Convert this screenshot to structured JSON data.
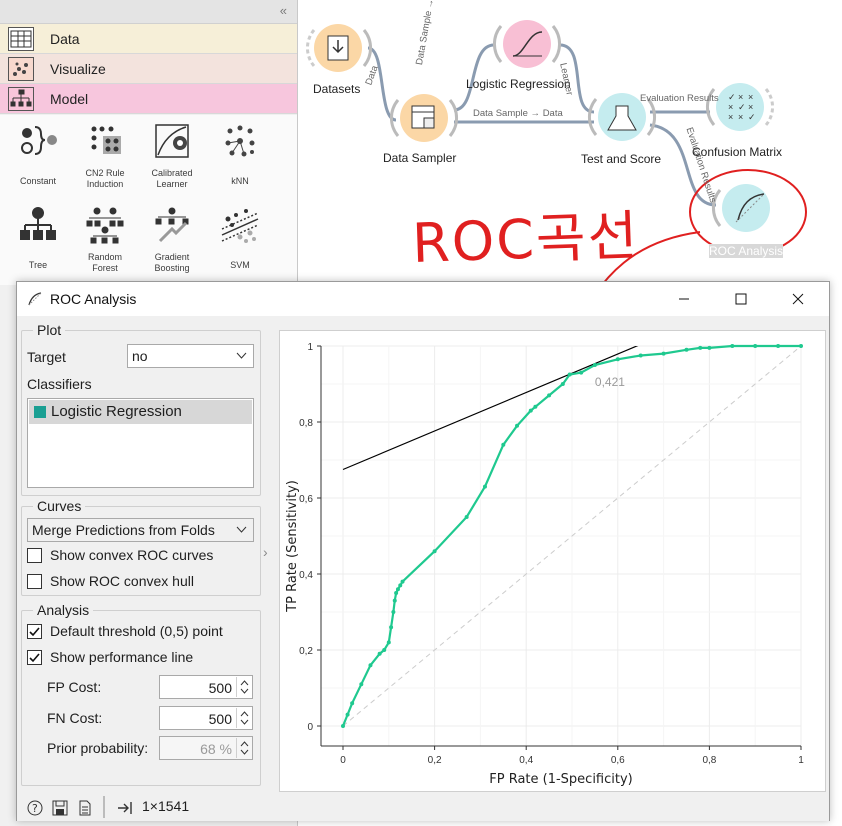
{
  "toolbox": {
    "categories": [
      {
        "label": "Data"
      },
      {
        "label": "Visualize"
      },
      {
        "label": "Model"
      }
    ],
    "widgets": [
      {
        "label": "Constant",
        "icon": "constant-icon"
      },
      {
        "label": "CN2 Rule\nInduction",
        "icon": "cn2-rule-induction-icon"
      },
      {
        "label": "Calibrated\nLearner",
        "icon": "calibrated-learner-icon"
      },
      {
        "label": "kNN",
        "icon": "knn-icon"
      },
      {
        "label": "Tree",
        "icon": "tree-icon"
      },
      {
        "label": "Random\nForest",
        "icon": "random-forest-icon"
      },
      {
        "label": "Gradient\nBoosting",
        "icon": "gradient-boosting-icon"
      },
      {
        "label": "SVM",
        "icon": "svm-icon"
      }
    ]
  },
  "workflow": {
    "nodes": {
      "datasets": "Datasets",
      "data_sampler": "Data Sampler",
      "logistic_regression": "Logistic Regression",
      "test_and_score": "Test and Score",
      "confusion_matrix": "Confusion Matrix",
      "roc_analysis": "ROC Analysis"
    },
    "links": {
      "datasets_to_sampler": "Data",
      "sampler_to_lr": "Data Sample → Data",
      "sampler_to_test": "Data Sample → Data",
      "lr_to_test": "Learner",
      "test_to_cm": "Evaluation Results",
      "test_to_roc": "Evaluation Results"
    },
    "annotation_text": "ROC곡선"
  },
  "roc_window": {
    "title": "ROC Analysis",
    "plot_group": {
      "title": "Plot",
      "target_label": "Target",
      "target_value": "no",
      "classifiers_label": "Classifiers",
      "classifiers": [
        "Logistic Regression"
      ]
    },
    "curves_group": {
      "title": "Curves",
      "merge_value": "Merge Predictions from Folds",
      "show_convex_curves": "Show convex ROC curves",
      "show_convex_hull": "Show ROC convex hull"
    },
    "analysis_group": {
      "title": "Analysis",
      "default_threshold": "Default threshold (0,5) point",
      "show_performance_line": "Show performance line",
      "fp_cost_label": "FP Cost:",
      "fp_cost": "500",
      "fn_cost_label": "FN Cost:",
      "fn_cost": "500",
      "prior_label": "Prior probability:",
      "prior": "68 %"
    },
    "status": {
      "summary": "1×1541"
    }
  },
  "chart_data": {
    "type": "line",
    "title": "",
    "xlabel": "FP Rate (1-Specificity)",
    "ylabel": "TP Rate (Sensitivity)",
    "xlim": [
      0,
      1
    ],
    "ylim": [
      0,
      1
    ],
    "x_ticks": [
      "0",
      "0,2",
      "0,4",
      "0,6",
      "0,8",
      "1"
    ],
    "y_ticks": [
      "0",
      "0,2",
      "0,4",
      "0,6",
      "0,8",
      "1"
    ],
    "grid": true,
    "series": [
      {
        "name": "Logistic Regression",
        "color": "#1fc98f",
        "x": [
          0.0,
          0.01,
          0.02,
          0.04,
          0.06,
          0.08,
          0.09,
          0.1,
          0.105,
          0.11,
          0.113,
          0.116,
          0.12,
          0.125,
          0.13,
          0.2,
          0.27,
          0.31,
          0.35,
          0.38,
          0.41,
          0.42,
          0.45,
          0.48,
          0.495,
          0.52,
          0.55,
          0.6,
          0.65,
          0.7,
          0.75,
          0.78,
          0.8,
          0.85,
          0.9,
          0.95,
          1.0
        ],
        "y": [
          0.0,
          0.03,
          0.06,
          0.11,
          0.16,
          0.19,
          0.2,
          0.22,
          0.26,
          0.3,
          0.33,
          0.35,
          0.36,
          0.37,
          0.38,
          0.46,
          0.55,
          0.63,
          0.74,
          0.79,
          0.83,
          0.84,
          0.87,
          0.9,
          0.925,
          0.93,
          0.95,
          0.965,
          0.975,
          0.98,
          0.99,
          0.995,
          0.995,
          1.0,
          1.0,
          1.0,
          1.0
        ]
      }
    ],
    "diagonal": {
      "from": [
        0,
        0
      ],
      "to": [
        1,
        1
      ],
      "style": "dashed",
      "color": "#cccccc"
    },
    "performance_line": {
      "from": [
        0,
        0.675
      ],
      "to": [
        0.76,
        1.06
      ],
      "color": "#000000"
    },
    "threshold_annotation": {
      "label": "0,421",
      "x": 0.55,
      "y": 0.905
    }
  }
}
